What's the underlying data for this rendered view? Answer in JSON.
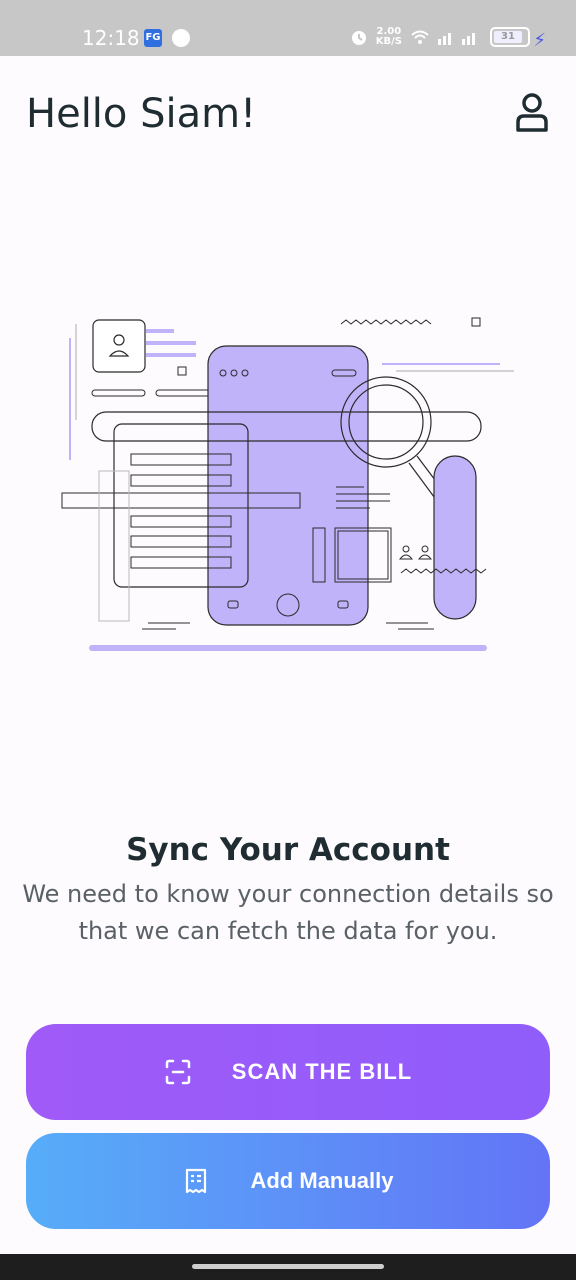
{
  "status_bar": {
    "time": "12:18",
    "app_icon_label": "FG",
    "speed_value": "2.00",
    "speed_unit": "KB/S",
    "battery_level": "31"
  },
  "header": {
    "greeting": "Hello Siam!",
    "profile_icon": "user-icon"
  },
  "main": {
    "illustration_icon": "phone-search-illustration",
    "title": "Sync Your Account",
    "description": "We need to know your connection details so that we can fetch the data for you."
  },
  "actions": {
    "scan_label": "SCAN THE BILL",
    "scan_icon": "scan-icon",
    "manual_label": "Add Manually",
    "manual_icon": "receipt-icon"
  },
  "colors": {
    "accent_purple": "#9b5cf9",
    "accent_blue": "#5f8af7",
    "illustration_fill": "#c0b3f9",
    "text_dark": "#1f2d33"
  }
}
